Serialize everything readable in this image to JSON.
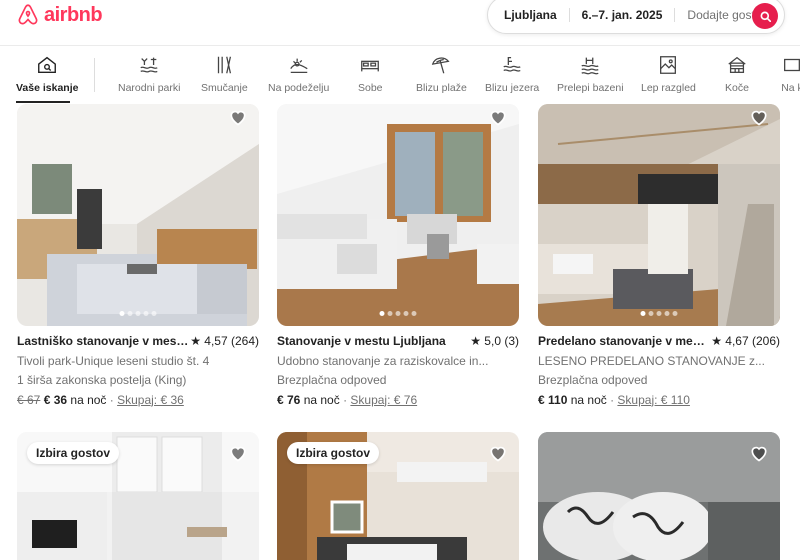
{
  "brand": {
    "name": "airbnb",
    "color": "#ff385c"
  },
  "search": {
    "location": "Ljubljana",
    "dates": "6.–7. jan. 2025",
    "guests_placeholder": "Dodajte goste",
    "button_color": "#e61e4d"
  },
  "categories": [
    {
      "label": "Vaše iskanje",
      "icon": "home-search-icon",
      "active": true
    },
    {
      "label": "Narodni parki",
      "icon": "national-park-icon"
    },
    {
      "label": "Smučanje",
      "icon": "skiing-icon"
    },
    {
      "label": "Na podeželju",
      "icon": "countryside-icon"
    },
    {
      "label": "Sobe",
      "icon": "bed-icon"
    },
    {
      "label": "Blizu plaže",
      "icon": "beach-umbrella-icon"
    },
    {
      "label": "Blizu jezera",
      "icon": "lake-icon"
    },
    {
      "label": "Prelepi bazeni",
      "icon": "pool-icon"
    },
    {
      "label": "Lep razgled",
      "icon": "view-icon"
    },
    {
      "label": "Koče",
      "icon": "cabin-icon"
    },
    {
      "label": "Na k",
      "icon": "chevron-right-icon"
    }
  ],
  "listings": [
    {
      "title": "Lastniško stanovanje v mestu ...",
      "rating": "★ 4,57 (264)",
      "line2": "Tivoli park-Unique leseni studio št. 4",
      "line3": "1 širša zakonska postelja (King)",
      "old_price": "€ 67",
      "price": "€ 36",
      "per": " na noč",
      "sep": " · ",
      "total": "Skupaj: € 36"
    },
    {
      "title": "Stanovanje v mestu Ljubljana",
      "rating": "★ 5,0 (3)",
      "line2": "Udobno stanovanje za raziskovalce in...",
      "line3": "Brezplačna odpoved",
      "price": "€ 76",
      "per": " na noč",
      "sep": " · ",
      "total": "Skupaj: € 76"
    },
    {
      "title": "Predelano stanovanje v mestu...",
      "rating": "★ 4,67 (206)",
      "line2": "LESENO PREDELANO STANOVANJE z...",
      "line3": "Brezplačna odpoved",
      "price": "€ 110",
      "per": " na noč",
      "sep": " · ",
      "total": "Skupaj: € 110"
    },
    {
      "badge": "Izbira gostov"
    },
    {
      "badge": "Izbira gostov"
    },
    {}
  ]
}
